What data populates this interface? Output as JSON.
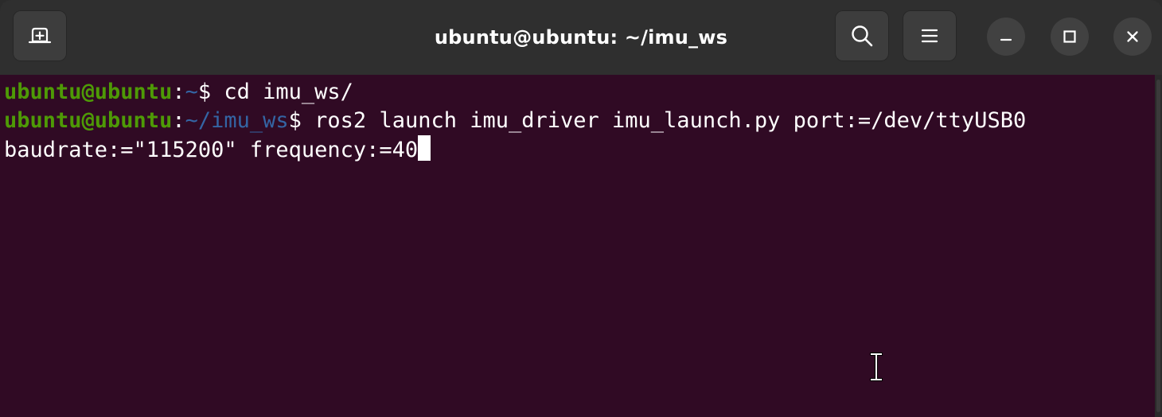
{
  "window": {
    "title": "ubuntu@ubuntu: ~/imu_ws"
  },
  "toolbar": {
    "new_tab_icon": "new-tab-icon",
    "search_icon": "search-icon",
    "menu_icon": "hamburger-menu-icon",
    "minimize_icon": "minimize-icon",
    "maximize_icon": "maximize-icon",
    "close_icon": "close-icon"
  },
  "terminal": {
    "lines": [
      {
        "user": "ubuntu@ubuntu",
        "colon": ":",
        "path": "~",
        "prompt": "$",
        "command": " cd imu_ws/"
      },
      {
        "user": "ubuntu@ubuntu",
        "colon": ":",
        "path": "~/imu_ws",
        "prompt": "$",
        "command": " ros2 launch imu_driver imu_launch.py port:=/dev/ttyUSB0"
      },
      {
        "continuation": "baudrate:=\"115200\" frequency:=40"
      }
    ]
  },
  "colors": {
    "background": "#300a24",
    "user": "#4e9a06",
    "path": "#3465a4",
    "text": "#ffffff",
    "titlebar": "#2f2f2f"
  }
}
